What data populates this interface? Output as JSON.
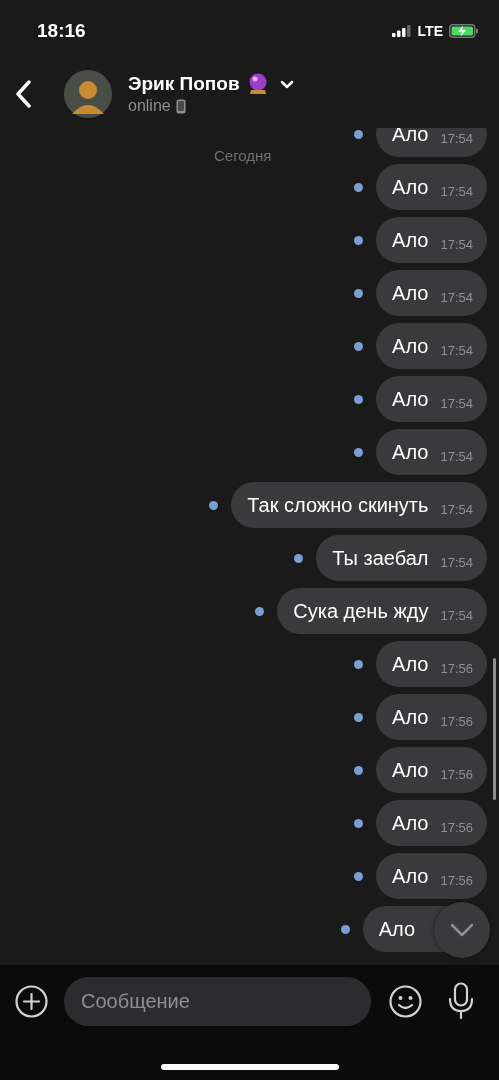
{
  "status_bar": {
    "time": "18:16",
    "network": "LTE"
  },
  "header": {
    "name": "Эрик Попов",
    "presence": "online"
  },
  "date_label": "Сегодня",
  "messages": [
    {
      "text": "Ало",
      "time": "17:54",
      "unread": true
    },
    {
      "text": "Ало",
      "time": "17:54",
      "unread": true
    },
    {
      "text": "Ало",
      "time": "17:54",
      "unread": true
    },
    {
      "text": "Ало",
      "time": "17:54",
      "unread": true
    },
    {
      "text": "Ало",
      "time": "17:54",
      "unread": true
    },
    {
      "text": "Ало",
      "time": "17:54",
      "unread": true
    },
    {
      "text": "Ало",
      "time": "17:54",
      "unread": true
    },
    {
      "text": "Так сложно скинуть",
      "time": "17:54",
      "unread": true
    },
    {
      "text": "Ты заебал",
      "time": "17:54",
      "unread": true
    },
    {
      "text": "Сука день жду",
      "time": "17:54",
      "unread": true
    },
    {
      "text": "Ало",
      "time": "17:56",
      "unread": true
    },
    {
      "text": "Ало",
      "time": "17:56",
      "unread": true
    },
    {
      "text": "Ало",
      "time": "17:56",
      "unread": true
    },
    {
      "text": "Ало",
      "time": "17:56",
      "unread": true
    },
    {
      "text": "Ало",
      "time": "17:56",
      "unread": true
    },
    {
      "text": "Ало",
      "unread": true
    }
  ],
  "composer": {
    "placeholder": "Сообщение"
  }
}
